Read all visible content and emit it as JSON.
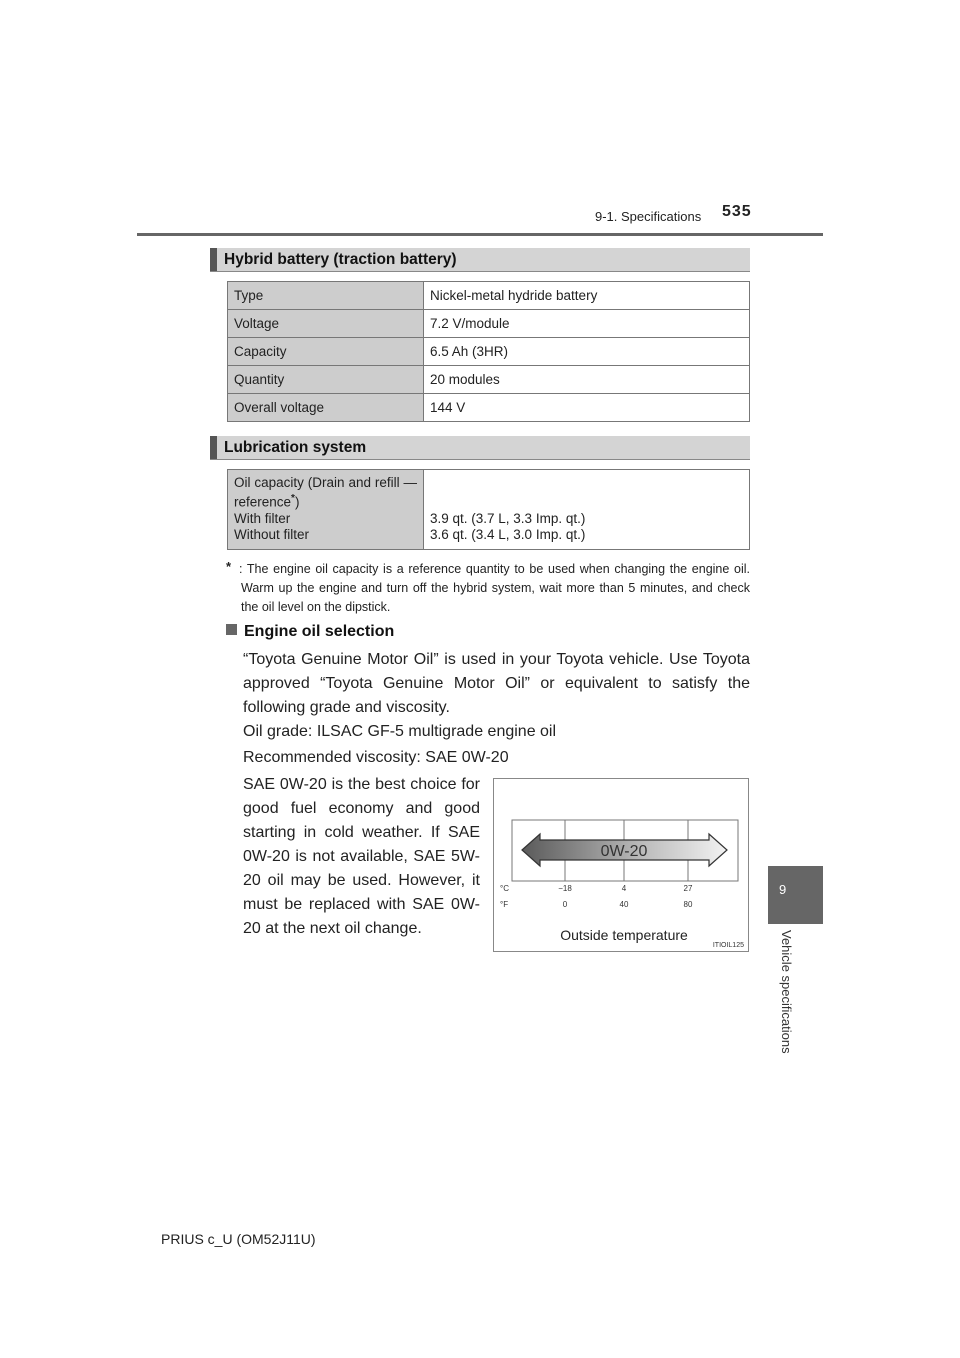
{
  "header": {
    "section": "9-1. Specifications",
    "page_number": "535"
  },
  "hybrid_battery": {
    "title": "Hybrid battery (traction battery)",
    "rows": [
      {
        "label": "Type",
        "value": "Nickel-metal hydride battery"
      },
      {
        "label": "Voltage",
        "value": "7.2 V/module"
      },
      {
        "label": "Capacity",
        "value": "6.5 Ah (3HR)"
      },
      {
        "label": "Quantity",
        "value": "20 modules"
      },
      {
        "label": "Overall voltage",
        "value": "144 V"
      }
    ]
  },
  "lubrication": {
    "title": "Lubrication system",
    "label_line1": "Oil capacity (Drain and refill — reference",
    "label_star": "*",
    "label_close": ")",
    "with_filter_label": "With filter",
    "without_filter_label": "Without filter",
    "with_filter_value": "3.9 qt. (3.7 L, 3.3 Imp. qt.)",
    "without_filter_value": "3.6 qt. (3.4 L, 3.0 Imp. qt.)",
    "footnote_marker": "*",
    "footnote": ": The engine oil capacity is a reference quantity to be used when changing the engine oil. Warm up the engine and turn off the hybrid system, wait more than 5 minutes, and check the oil level on the dipstick."
  },
  "engine_oil": {
    "heading": "Engine oil selection",
    "para1": "“Toyota Genuine Motor Oil” is used in your Toyota vehicle. Use Toyota approved “Toyota Genuine Motor Oil” or equivalent to satisfy the following grade and viscosity.",
    "oil_grade": "Oil grade: ILSAC GF-5 multigrade engine oil",
    "viscosity": "Recommended viscosity: SAE 0W-20",
    "side_text": "SAE 0W-20 is the best choice for good fuel economy and good starting in cold weather. If SAE 0W-20 is not available, SAE 5W-20 oil may be used. However, it must be replaced with SAE 0W-20 at the next oil change."
  },
  "figure": {
    "arrow_label": "0W-20",
    "celsius_unit": "°C",
    "fahrenheit_unit": "°F",
    "celsius_ticks": [
      "−18",
      "4",
      "27"
    ],
    "fahrenheit_ticks": [
      "0",
      "40",
      "80"
    ],
    "caption": "Outside temperature",
    "code": "ITIOIL125"
  },
  "chapter": {
    "number": "9",
    "label": "Vehicle specifications"
  },
  "footer": {
    "model": "PRIUS c_U (OM52J11U)"
  }
}
